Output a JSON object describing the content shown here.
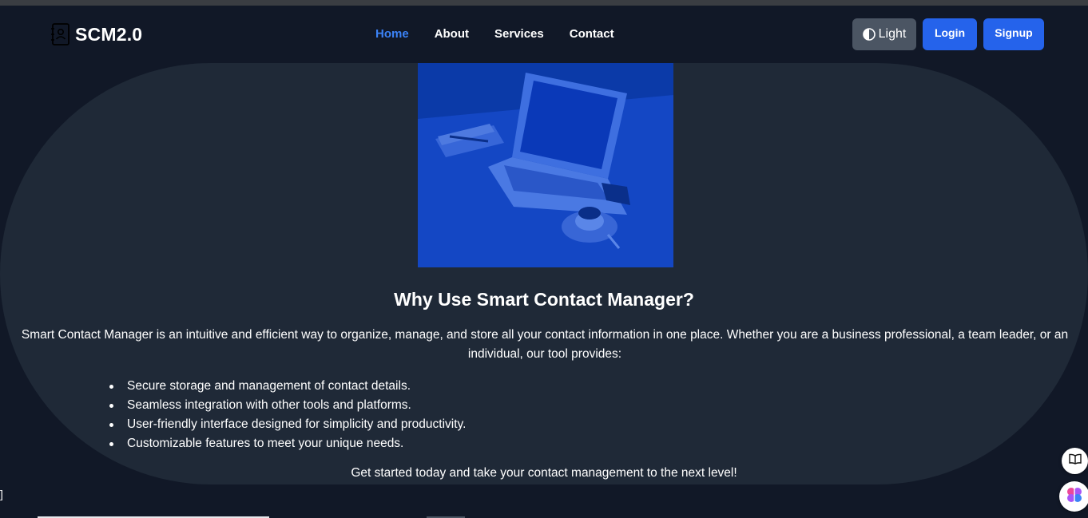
{
  "brand": {
    "name": "SCM2.0",
    "icon": "contact-book-icon"
  },
  "nav": {
    "links": [
      {
        "label": "Home",
        "active": true
      },
      {
        "label": "About",
        "active": false
      },
      {
        "label": "Services",
        "active": false
      },
      {
        "label": "Contact",
        "active": false
      }
    ],
    "active_color": "#3b82f6"
  },
  "actions": {
    "theme_toggle": {
      "label": "Light",
      "icon": "half-circle-icon"
    },
    "login_label": "Login",
    "signup_label": "Signup",
    "primary_color": "#2563eb"
  },
  "hero": {
    "image": "laptop-desk-photo",
    "title": "Why Use Smart Contact Manager?",
    "description": "Smart Contact Manager is an intuitive and efficient way to organize, manage, and store all your contact information in one place. Whether you are a business professional, a team leader, or an individual, our tool provides:",
    "features": [
      "Secure storage and management of contact details.",
      "Seamless integration with other tools and platforms.",
      "User-friendly interface designed for simplicity and productivity.",
      "Customizable features to meet your unique needs."
    ],
    "cta": "Get started today and take your contact management to the next level!"
  },
  "misc": {
    "stray_text": "]",
    "floating_buttons": [
      "book-icon",
      "brain-icon"
    ]
  },
  "colors": {
    "page_bg": "#111827",
    "hero_bg": "#1f2937"
  }
}
